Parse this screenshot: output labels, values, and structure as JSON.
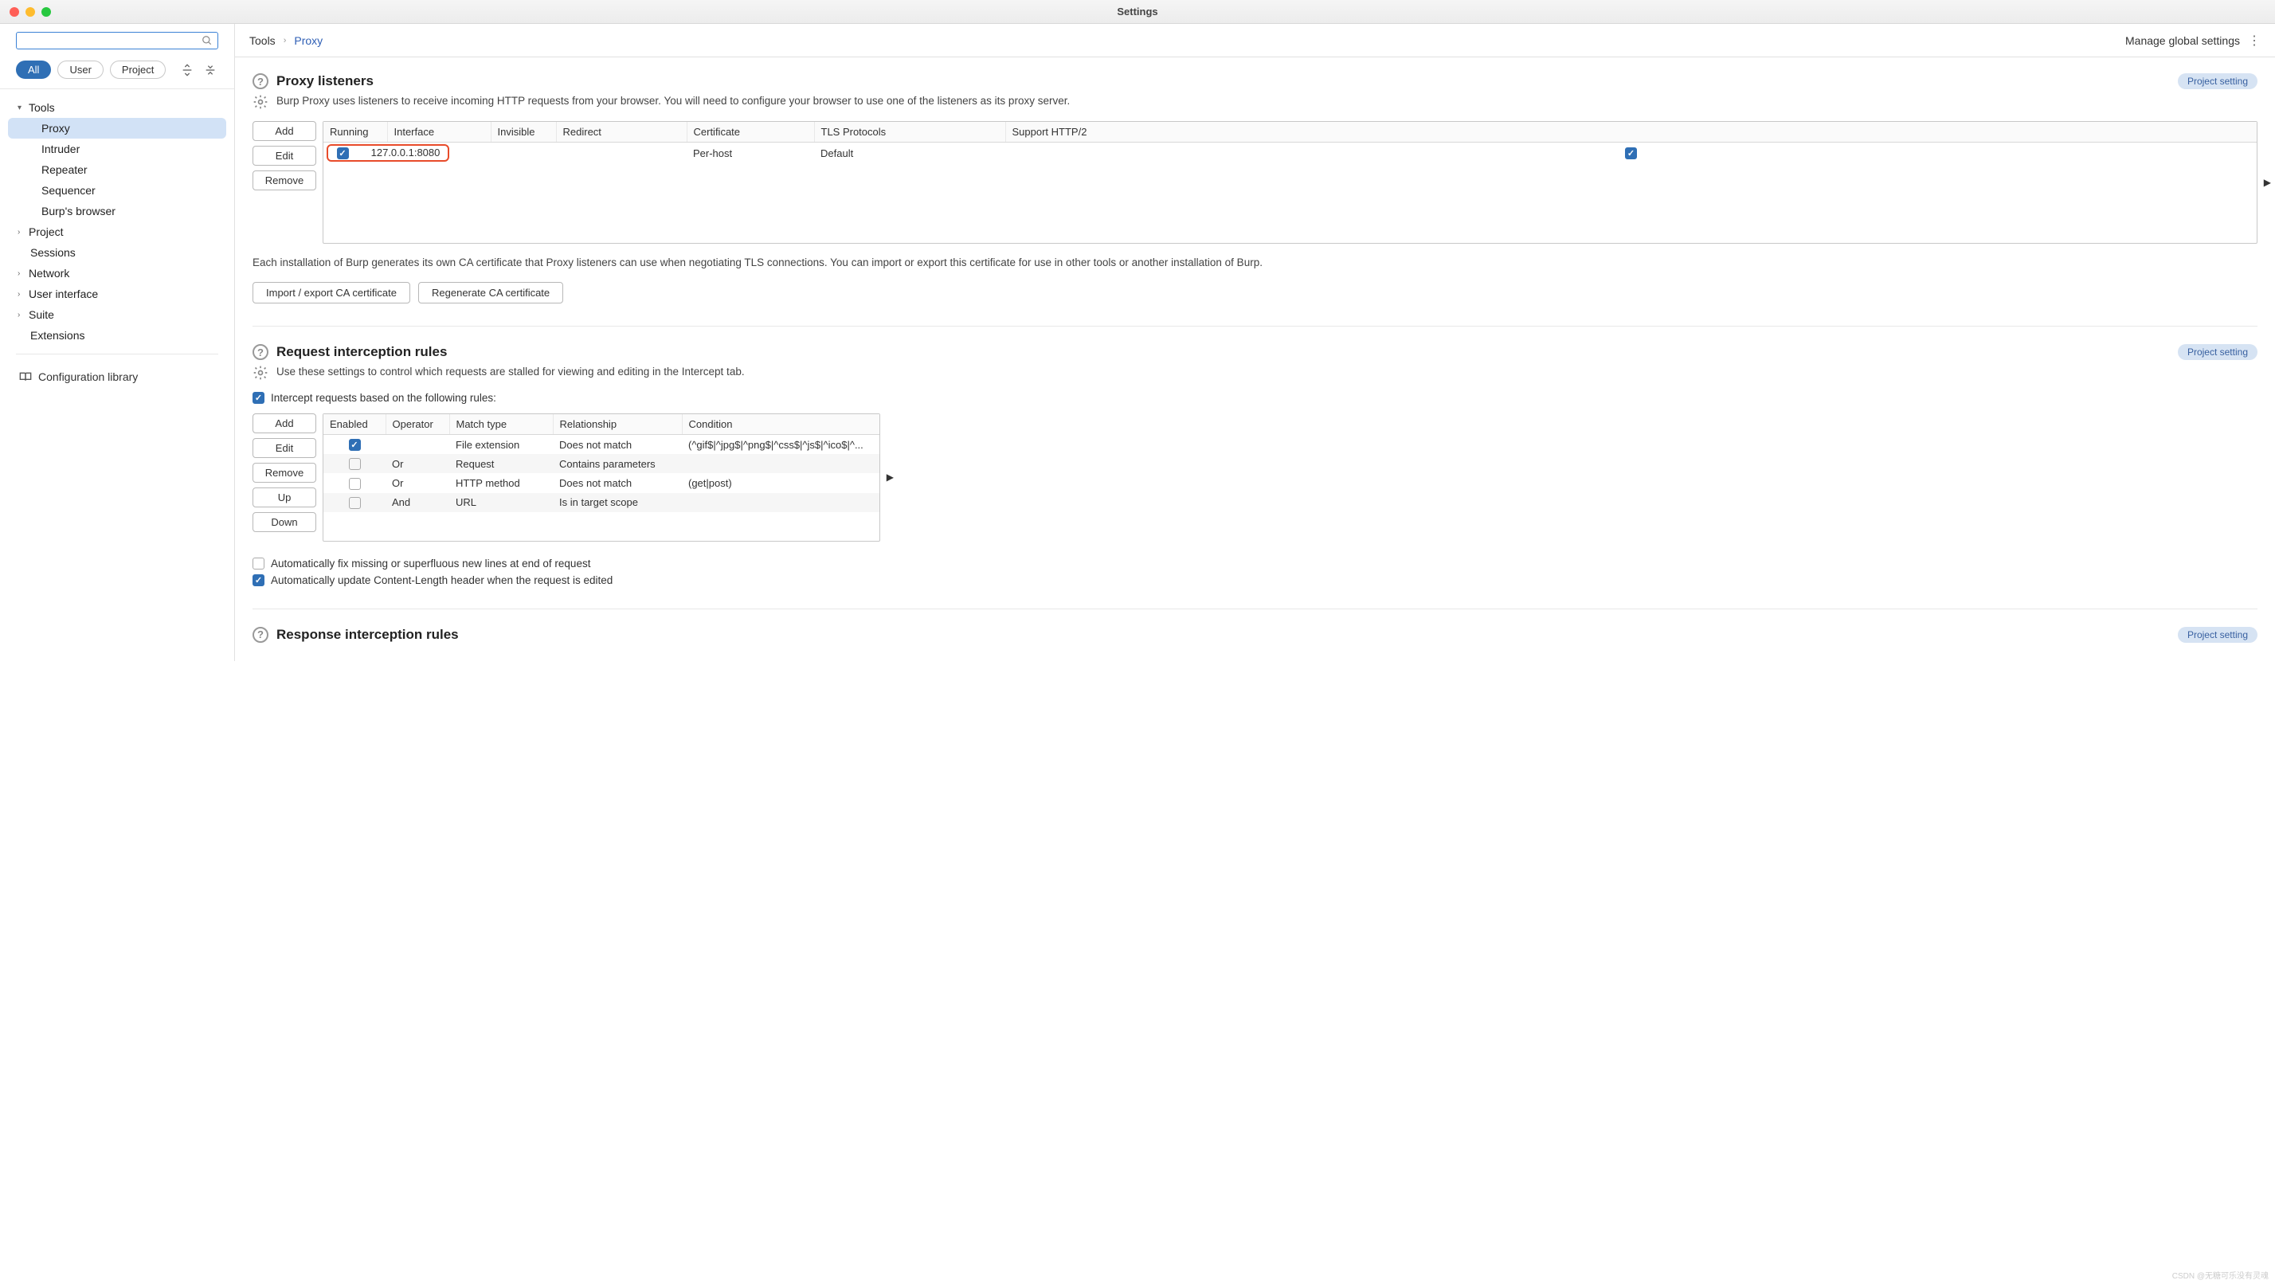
{
  "window": {
    "title": "Settings"
  },
  "sidebar": {
    "search_placeholder": "",
    "filters": {
      "all": "All",
      "user": "User",
      "project": "Project"
    },
    "tree": {
      "tools": "Tools",
      "proxy": "Proxy",
      "intruder": "Intruder",
      "repeater": "Repeater",
      "sequencer": "Sequencer",
      "burps_browser": "Burp's browser",
      "project_item": "Project",
      "sessions": "Sessions",
      "network": "Network",
      "user_interface": "User interface",
      "suite": "Suite",
      "extensions": "Extensions"
    },
    "config_lib": "Configuration library"
  },
  "crumb": {
    "tools": "Tools",
    "proxy": "Proxy",
    "manage": "Manage global settings"
  },
  "badges": {
    "project_setting": "Project setting"
  },
  "listeners": {
    "title": "Proxy listeners",
    "desc": "Burp Proxy uses listeners to receive incoming HTTP requests from your browser. You will need to configure your browser to use one of the listeners as its proxy server.",
    "buttons": {
      "add": "Add",
      "edit": "Edit",
      "remove": "Remove"
    },
    "cols": {
      "running": "Running",
      "interface": "Interface",
      "invisible": "Invisible",
      "redirect": "Redirect",
      "certificate": "Certificate",
      "tls": "TLS Protocols",
      "http2": "Support HTTP/2"
    },
    "rows": [
      {
        "running": true,
        "interface": "127.0.0.1:8080",
        "invisible": "",
        "redirect": "",
        "certificate": "Per-host",
        "tls": "Default",
        "http2": true
      }
    ],
    "ca_note": "Each installation of Burp generates its own CA certificate that Proxy listeners can use when negotiating TLS connections. You can import or export this certificate for use in other tools or another installation of Burp.",
    "ca_buttons": {
      "import_export": "Import / export CA certificate",
      "regenerate": "Regenerate CA certificate"
    }
  },
  "intercept_req": {
    "title": "Request interception rules",
    "desc": "Use these settings to control which requests are stalled for viewing and editing in the Intercept tab.",
    "master_check": "Intercept requests based on the following rules:",
    "buttons": {
      "add": "Add",
      "edit": "Edit",
      "remove": "Remove",
      "up": "Up",
      "down": "Down"
    },
    "cols": {
      "enabled": "Enabled",
      "operator": "Operator",
      "match_type": "Match type",
      "relationship": "Relationship",
      "condition": "Condition"
    },
    "rows": [
      {
        "enabled": true,
        "operator": "",
        "match_type": "File extension",
        "relationship": "Does not match",
        "condition": "(^gif$|^jpg$|^png$|^css$|^js$|^ico$|^..."
      },
      {
        "enabled": false,
        "operator": "Or",
        "match_type": "Request",
        "relationship": "Contains parameters",
        "condition": ""
      },
      {
        "enabled": false,
        "operator": "Or",
        "match_type": "HTTP method",
        "relationship": "Does not match",
        "condition": "(get|post)"
      },
      {
        "enabled": false,
        "operator": "And",
        "match_type": "URL",
        "relationship": "Is in target scope",
        "condition": ""
      }
    ],
    "auto_fix": "Automatically fix missing or superfluous new lines at end of request",
    "auto_len": "Automatically update Content-Length header when the request is edited"
  },
  "intercept_res": {
    "title": "Response interception rules"
  },
  "watermark": "CSDN @无糖可乐没有灵魂"
}
